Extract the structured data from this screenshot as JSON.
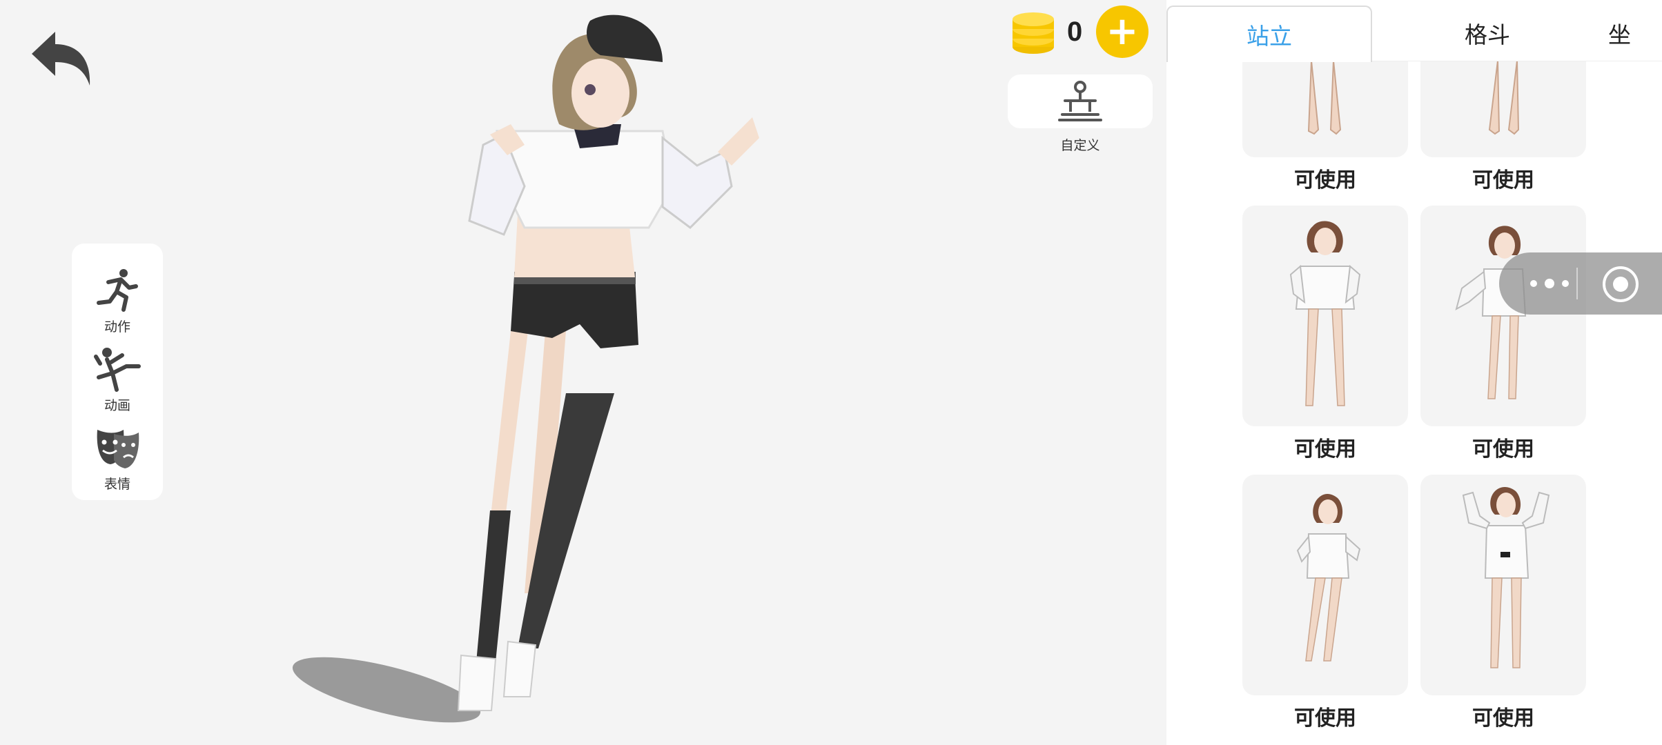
{
  "toolbar": {
    "coins": "0",
    "plus_label": "+",
    "custom_label": "自定义"
  },
  "side_menu": {
    "items": [
      {
        "label": "动作",
        "icon": "running-icon"
      },
      {
        "label": "动画",
        "icon": "ballet-icon"
      },
      {
        "label": "表情",
        "icon": "theater-masks-icon"
      }
    ]
  },
  "tabs": [
    {
      "label": "站立",
      "active": true
    },
    {
      "label": "格斗",
      "active": false
    },
    {
      "label": "坐",
      "active": false
    }
  ],
  "poses": [
    {
      "label": "可使用"
    },
    {
      "label": "可使用"
    },
    {
      "label": "可使用"
    },
    {
      "label": "可使用"
    },
    {
      "label": "可使用"
    },
    {
      "label": "可使用"
    }
  ],
  "colors": {
    "accent": "#3aa0e8",
    "coin": "#f7c600",
    "background": "#f4f4f4"
  }
}
